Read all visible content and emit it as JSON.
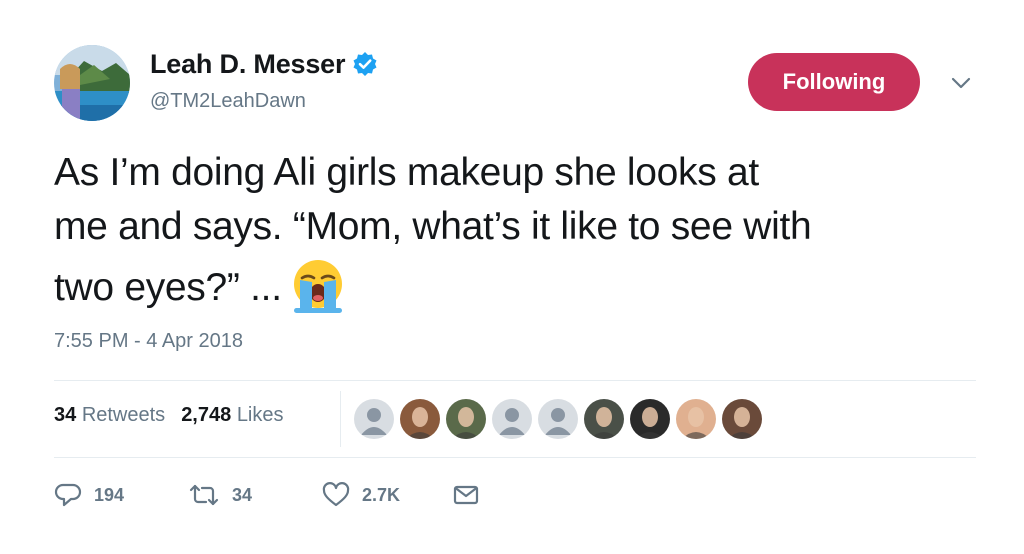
{
  "user": {
    "display_name": "Leah D. Messer",
    "handle": "@TM2LeahDawn",
    "verified": true,
    "avatar_icon": "profile-photo"
  },
  "follow_button": {
    "label": "Following",
    "color": "#c8325a"
  },
  "menu": {
    "icon": "chevron-down-icon"
  },
  "tweet": {
    "lines": [
      "As I’m doing Ali girls makeup she looks at",
      "me and says. “Mom, what’s it like to see with",
      "two eyes?” ..."
    ],
    "emoji": "loudly-crying-face",
    "timestamp": "7:55 PM - 4 Apr 2018"
  },
  "stats": {
    "retweets": {
      "count": "34",
      "label": "Retweets"
    },
    "likes": {
      "count": "2,748",
      "label": "Likes"
    }
  },
  "likers": [
    {
      "kind": "default"
    },
    {
      "kind": "photo",
      "color": "#8a5a3c"
    },
    {
      "kind": "photo",
      "color": "#5a6a4a"
    },
    {
      "kind": "default"
    },
    {
      "kind": "default"
    },
    {
      "kind": "photo",
      "color": "#4a5048"
    },
    {
      "kind": "photo",
      "color": "#2a2a2a"
    },
    {
      "kind": "photo",
      "color": "#e0b090"
    },
    {
      "kind": "photo",
      "color": "#6a4a3a"
    }
  ],
  "actions": {
    "reply": {
      "icon": "reply-icon",
      "count": "194"
    },
    "retweet": {
      "icon": "retweet-icon",
      "count": "34"
    },
    "like": {
      "icon": "heart-icon",
      "count": "2.7K"
    },
    "message": {
      "icon": "envelope-icon"
    }
  },
  "colors": {
    "text": "#14171a",
    "secondary": "#657786",
    "verified_blue": "#1da1f2",
    "divider": "#e6ecf0"
  }
}
